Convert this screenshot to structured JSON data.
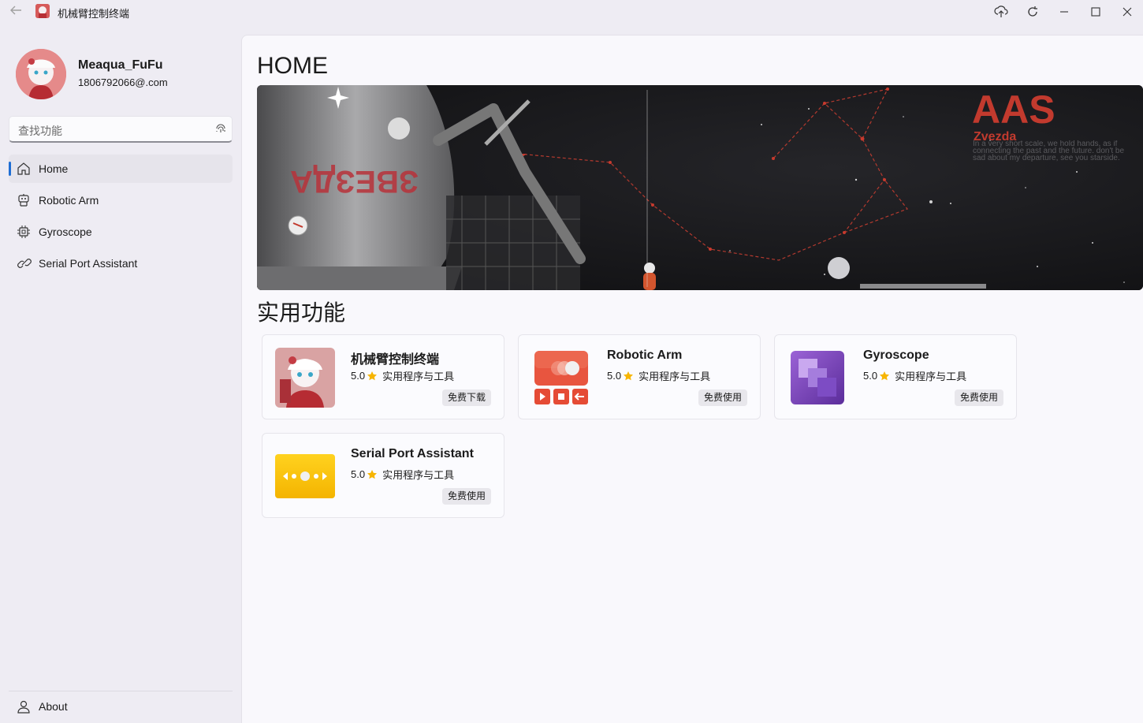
{
  "window": {
    "title": "机械臂控制终端"
  },
  "user": {
    "name": "Meaqua_FuFu",
    "email": "1806792066@.com"
  },
  "search": {
    "placeholder": "查找功能"
  },
  "nav": {
    "items": [
      {
        "label": "Home",
        "icon": "home-icon",
        "active": true
      },
      {
        "label": "Robotic Arm",
        "icon": "robot-icon",
        "active": false
      },
      {
        "label": "Gyroscope",
        "icon": "chip-icon",
        "active": false
      },
      {
        "label": "Serial Port Assistant",
        "icon": "link-icon",
        "active": false
      }
    ],
    "footer": {
      "label": "About",
      "icon": "person-icon"
    }
  },
  "main": {
    "title": "HOME",
    "banner": {
      "brand": "AAS",
      "subtitle": "Zvezda",
      "tagline": "In a very short scale, we hold hands, as if connecting the past and the future. don't be sad about my departure, see you starside.",
      "module_text": "ЗВЕЗДА"
    },
    "section_title": "实用功能",
    "cards": [
      {
        "title": "机械臂控制终端",
        "rating": "5.0",
        "category": "实用程序与工具",
        "button": "免费下载",
        "icon": "avatar-app-icon"
      },
      {
        "title": "Robotic Arm",
        "rating": "5.0",
        "category": "实用程序与工具",
        "button": "免费使用",
        "icon": "media-player-icon"
      },
      {
        "title": "Gyroscope",
        "rating": "5.0",
        "category": "实用程序与工具",
        "button": "免费使用",
        "icon": "layers-icon"
      },
      {
        "title": "Serial Port Assistant",
        "rating": "5.0",
        "category": "实用程序与工具",
        "button": "免费使用",
        "icon": "dots-arrows-icon"
      }
    ]
  },
  "colors": {
    "accent": "#1f6ed4",
    "star": "#f7b500",
    "banner_brand": "#c23a2e"
  }
}
